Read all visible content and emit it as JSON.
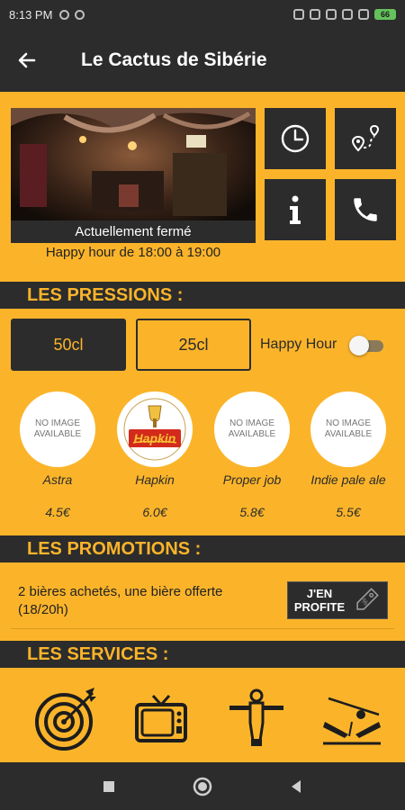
{
  "status_bar": {
    "time": "8:13 PM",
    "battery": "66"
  },
  "app_bar": {
    "title": "Le Cactus de Sibérie",
    "back_icon": "arrow-left-icon"
  },
  "hero": {
    "caption": "Actuellement fermé",
    "happy_hour": "Happy hour de 18:00 à 19:00"
  },
  "tiles": [
    {
      "icon": "clock-icon"
    },
    {
      "icon": "map-route-icon"
    },
    {
      "icon": "info-icon"
    },
    {
      "icon": "phone-icon"
    }
  ],
  "pressions": {
    "heading": "LES PRESSIONS :",
    "size_50": "50cl",
    "size_25": "25cl",
    "selected": "50cl",
    "happy_hour_label": "Happy Hour",
    "happy_hour_on": false
  },
  "beers": [
    {
      "name": "Astra",
      "price": "4.5€",
      "image_text": "NO IMAGE\nAVAILABLE"
    },
    {
      "name": "Hapkin",
      "price": "6.0€",
      "logo_text": "Hapkin"
    },
    {
      "name": "Proper job",
      "price": "5.8€",
      "image_text": "NO IMAGE\nAVAILABLE"
    },
    {
      "name": "Indie pale ale",
      "price": "5.5€",
      "image_text": "NO IMAGE\nAVAILABLE"
    }
  ],
  "promotions": {
    "heading": "LES PROMOTIONS :",
    "text": "2 bières achetés, une bière offerte (18/20h)",
    "button_label": "J'EN PROFITE"
  },
  "services": {
    "heading": "LES SERVICES :",
    "items": [
      "darts-icon",
      "tv-icon",
      "foosball-icon",
      "pinball-icon"
    ]
  },
  "colors": {
    "accent": "#fbb42a",
    "dark": "#2c2c2c"
  }
}
